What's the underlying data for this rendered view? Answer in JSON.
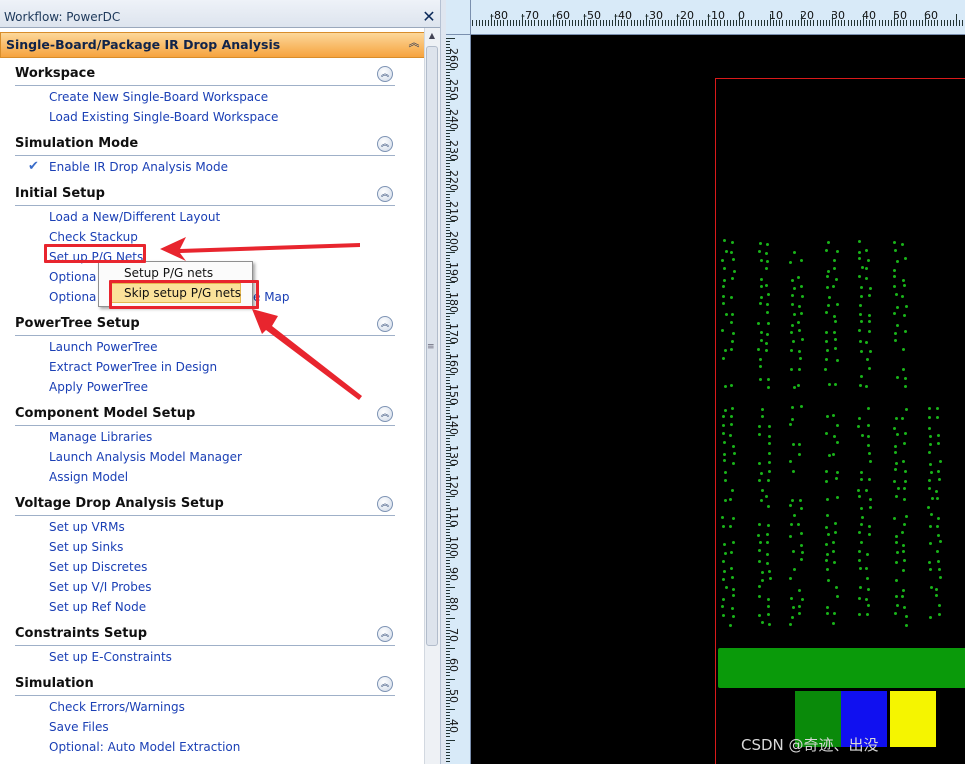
{
  "window": {
    "title": "Workflow: PowerDC",
    "close_label": "✕"
  },
  "workflow": {
    "header": "Single-Board/Package IR Drop Analysis",
    "collapse_glyph": "︽"
  },
  "sections": [
    {
      "title": "Workspace",
      "items": [
        "Create New Single-Board Workspace",
        "Load Existing Single-Board Workspace"
      ]
    },
    {
      "title": "Simulation Mode",
      "items": [
        "Enable IR Drop Analysis Mode"
      ]
    },
    {
      "title": "Initial Setup",
      "items": [
        "Load a New/Different Layout",
        "Check Stackup",
        "Set up P/G Nets",
        "Optiona",
        "Optiona",
        "e Map"
      ]
    },
    {
      "title": "PowerTree Setup",
      "items": [
        "Launch PowerTree",
        "Extract PowerTree in Design",
        "Apply PowerTree"
      ]
    },
    {
      "title": "Component Model Setup",
      "items": [
        "Manage Libraries",
        "Launch Analysis Model Manager",
        "Assign Model"
      ]
    },
    {
      "title": "Voltage Drop Analysis Setup",
      "items": [
        "Set up VRMs",
        "Set up Sinks",
        "Set up Discretes",
        "Set up V/I Probes",
        "Set up Ref Node"
      ]
    },
    {
      "title": "Constraints Setup",
      "items": [
        "Set up E-Constraints"
      ]
    },
    {
      "title": "Simulation",
      "items": [
        "Check Errors/Warnings",
        "Save Files",
        "Optional: Auto Model Extraction"
      ]
    }
  ],
  "check_mark": "✔",
  "section_button_glyph": "︽",
  "context_menu": {
    "items": [
      "Setup P/G nets",
      "Skip setup P/G nets"
    ]
  },
  "ruler": {
    "top_labels": [
      "-80",
      "-70",
      "-60",
      "-50",
      "-40",
      "-30",
      "-20",
      "-10",
      "0",
      "10",
      "20",
      "30",
      "40",
      "50",
      "60"
    ],
    "left_labels": [
      "260",
      "250",
      "240",
      "230",
      "220",
      "210",
      "200",
      "190",
      "180",
      "170",
      "160",
      "150",
      "140",
      "130",
      "120",
      "110",
      "100",
      "90",
      "80",
      "70",
      "60",
      "50",
      "40"
    ]
  },
  "colors": {
    "canvas": "#000000",
    "board_outline": "#d91a1a",
    "pin": "#19b319",
    "bar": "#0a9a0a",
    "block_green": "#0a8a0a",
    "block_blue": "#1010f0",
    "block_yellow": "#f5f500",
    "annotation_red": "#e8252e",
    "menu_highlight": "#fbe29a"
  },
  "watermark": "CSDN @奇迹、出没"
}
